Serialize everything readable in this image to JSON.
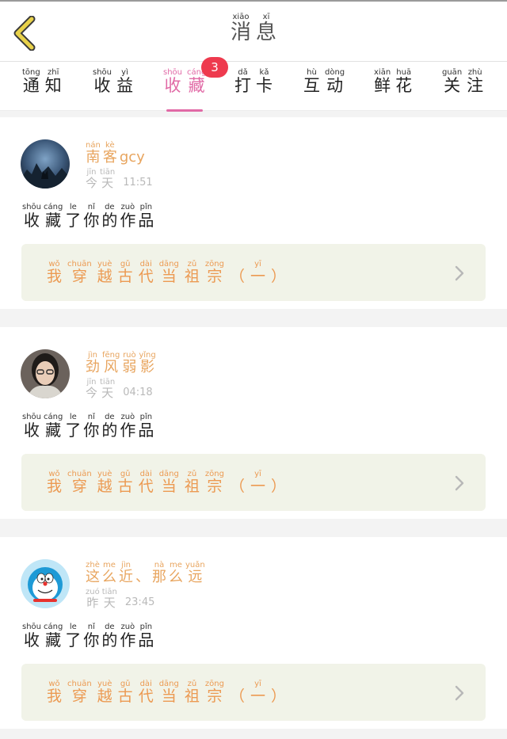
{
  "header": {
    "title": [
      {
        "py": "xiāo",
        "hz": "消"
      },
      {
        "py": "xī",
        "hz": "息"
      }
    ]
  },
  "tabs": [
    {
      "chars": [
        {
          "py": "tōng",
          "hz": "通"
        },
        {
          "py": "zhī",
          "hz": "知"
        }
      ],
      "active": false
    },
    {
      "chars": [
        {
          "py": "shōu",
          "hz": "收"
        },
        {
          "py": "yì",
          "hz": "益"
        }
      ],
      "active": false
    },
    {
      "chars": [
        {
          "py": "shōu",
          "hz": "收"
        },
        {
          "py": "cáng",
          "hz": "藏"
        }
      ],
      "active": true,
      "badge": "3"
    },
    {
      "chars": [
        {
          "py": "dǎ",
          "hz": "打"
        },
        {
          "py": "kǎ",
          "hz": "卡"
        }
      ],
      "active": false
    },
    {
      "chars": [
        {
          "py": "hù",
          "hz": "互"
        },
        {
          "py": "dòng",
          "hz": "动"
        }
      ],
      "active": false
    },
    {
      "chars": [
        {
          "py": "xiān",
          "hz": "鲜"
        },
        {
          "py": "huā",
          "hz": "花"
        }
      ],
      "active": false
    },
    {
      "chars": [
        {
          "py": "guān",
          "hz": "关"
        },
        {
          "py": "zhù",
          "hz": "注"
        }
      ],
      "active": false
    }
  ],
  "notifications": [
    {
      "avatar": "night-wolf-avatar",
      "user": [
        {
          "py": "nán",
          "hz": "南"
        },
        {
          "py": "kè",
          "hz": "客"
        },
        {
          "py": "",
          "hz": "gcy"
        }
      ],
      "day": [
        {
          "py": "jīn",
          "hz": "今"
        },
        {
          "py": "tiān",
          "hz": "天"
        }
      ],
      "time": "11:51",
      "action": [
        {
          "py": "shōu",
          "hz": "收"
        },
        {
          "py": "cáng",
          "hz": "藏"
        },
        {
          "py": "le",
          "hz": "了"
        },
        {
          "py": "nǐ",
          "hz": "你"
        },
        {
          "py": "de",
          "hz": "的"
        },
        {
          "py": "zuò",
          "hz": "作"
        },
        {
          "py": "pǐn",
          "hz": "品"
        }
      ],
      "work": [
        {
          "py": "wǒ",
          "hz": "我"
        },
        {
          "py": "chuān",
          "hz": "穿"
        },
        {
          "py": "yuè",
          "hz": "越"
        },
        {
          "py": "gǔ",
          "hz": "古"
        },
        {
          "py": "dài",
          "hz": "代"
        },
        {
          "py": "dāng",
          "hz": "当"
        },
        {
          "py": "zǔ",
          "hz": "祖"
        },
        {
          "py": "zōng",
          "hz": "宗"
        },
        {
          "py": "",
          "hz": "（"
        },
        {
          "py": "yī",
          "hz": "一"
        },
        {
          "py": "",
          "hz": "）"
        }
      ]
    },
    {
      "avatar": "girl-photo-avatar",
      "user": [
        {
          "py": "jìn",
          "hz": "劲"
        },
        {
          "py": "fēng",
          "hz": "风"
        },
        {
          "py": "ruò",
          "hz": "弱"
        },
        {
          "py": "yǐng",
          "hz": "影"
        }
      ],
      "day": [
        {
          "py": "jīn",
          "hz": "今"
        },
        {
          "py": "tiān",
          "hz": "天"
        }
      ],
      "time": "04:18",
      "action": [
        {
          "py": "shōu",
          "hz": "收"
        },
        {
          "py": "cáng",
          "hz": "藏"
        },
        {
          "py": "le",
          "hz": "了"
        },
        {
          "py": "nǐ",
          "hz": "你"
        },
        {
          "py": "de",
          "hz": "的"
        },
        {
          "py": "zuò",
          "hz": "作"
        },
        {
          "py": "pǐn",
          "hz": "品"
        }
      ],
      "work": [
        {
          "py": "wǒ",
          "hz": "我"
        },
        {
          "py": "chuān",
          "hz": "穿"
        },
        {
          "py": "yuè",
          "hz": "越"
        },
        {
          "py": "gǔ",
          "hz": "古"
        },
        {
          "py": "dài",
          "hz": "代"
        },
        {
          "py": "dāng",
          "hz": "当"
        },
        {
          "py": "zǔ",
          "hz": "祖"
        },
        {
          "py": "zōng",
          "hz": "宗"
        },
        {
          "py": "",
          "hz": "（"
        },
        {
          "py": "yī",
          "hz": "一"
        },
        {
          "py": "",
          "hz": "）"
        }
      ]
    },
    {
      "avatar": "doraemon-avatar",
      "user": [
        {
          "py": "zhè",
          "hz": "这"
        },
        {
          "py": "me",
          "hz": "么"
        },
        {
          "py": "jìn",
          "hz": "近"
        },
        {
          "py": "",
          "hz": "、"
        },
        {
          "py": "nà",
          "hz": "那"
        },
        {
          "py": "me",
          "hz": "么"
        },
        {
          "py": "yuǎn",
          "hz": "远"
        }
      ],
      "day": [
        {
          "py": "zuó",
          "hz": "昨"
        },
        {
          "py": "tiān",
          "hz": "天"
        }
      ],
      "time": "23:45",
      "action": [
        {
          "py": "shōu",
          "hz": "收"
        },
        {
          "py": "cáng",
          "hz": "藏"
        },
        {
          "py": "le",
          "hz": "了"
        },
        {
          "py": "nǐ",
          "hz": "你"
        },
        {
          "py": "de",
          "hz": "的"
        },
        {
          "py": "zuò",
          "hz": "作"
        },
        {
          "py": "pǐn",
          "hz": "品"
        }
      ],
      "work": [
        {
          "py": "wǒ",
          "hz": "我"
        },
        {
          "py": "chuān",
          "hz": "穿"
        },
        {
          "py": "yuè",
          "hz": "越"
        },
        {
          "py": "gǔ",
          "hz": "古"
        },
        {
          "py": "dài",
          "hz": "代"
        },
        {
          "py": "dāng",
          "hz": "当"
        },
        {
          "py": "zǔ",
          "hz": "祖"
        },
        {
          "py": "zōng",
          "hz": "宗"
        },
        {
          "py": "",
          "hz": "（"
        },
        {
          "py": "yī",
          "hz": "一"
        },
        {
          "py": "",
          "hz": "）"
        }
      ]
    }
  ],
  "colors": {
    "accent_pink": "#e16aa6",
    "badge_red": "#ee3a4e",
    "username_orange": "#e8a55f",
    "work_title_orange": "#ec9a52",
    "work_box_bg": "#f1f3e8",
    "meta_gray": "#b9b9b9"
  },
  "icons": {
    "back": "chevron-left-icon",
    "work_link": "chevron-right-icon"
  }
}
